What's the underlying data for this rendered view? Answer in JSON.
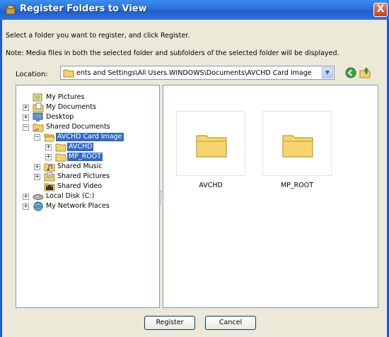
{
  "window": {
    "title": "Register Folders to View",
    "close_label": "X"
  },
  "instructions": {
    "line1": "Select a folder you want to register, and click Register.",
    "line2": "Note: Media files in both the selected folder and subfolders of the selected folder will be displayed."
  },
  "location": {
    "label": "Location:",
    "value": "ents and Settings\\All Users.WINDOWS\\Documents\\AVCHD Card Image"
  },
  "tree": {
    "items": [
      {
        "label": "My Pictures"
      },
      {
        "label": "My Documents"
      },
      {
        "label": "Desktop"
      },
      {
        "label": "Shared Documents"
      },
      {
        "label": "AVCHD Card Image"
      },
      {
        "label": "AVCHD"
      },
      {
        "label": "MP_ROOT"
      },
      {
        "label": "Shared Music"
      },
      {
        "label": "Shared Pictures"
      },
      {
        "label": "Shared Video"
      },
      {
        "label": "Local Disk (C:)"
      },
      {
        "label": "My Network Places"
      }
    ]
  },
  "content": {
    "folders": [
      {
        "label": "AVCHD"
      },
      {
        "label": "MP_ROOT"
      }
    ]
  },
  "buttons": {
    "register": "Register",
    "cancel": "Cancel"
  },
  "colors": {
    "titlebar": "#2a6fd8",
    "selection": "#316ac5",
    "dialog_bg": "#ece9d8"
  }
}
